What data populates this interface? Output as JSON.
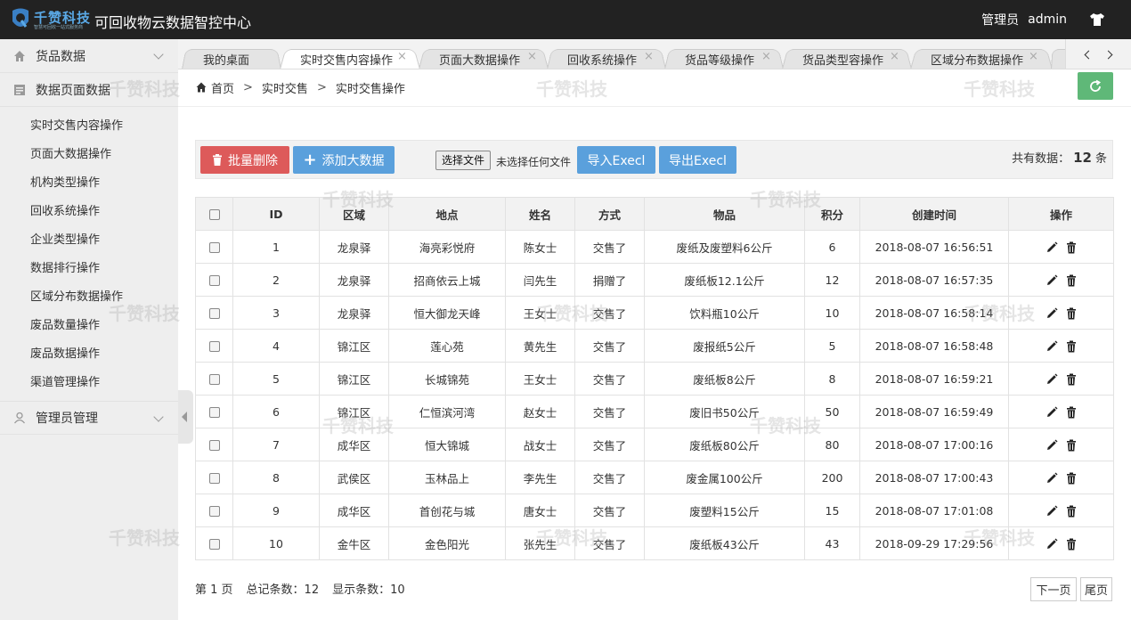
{
  "header": {
    "logo_text": "千赞科技",
    "logo_sub": "智慧可回收一站式服务商",
    "app_title": "可回收物云数据智控中心",
    "admin_role": "管理员",
    "admin_name": "admin"
  },
  "sidebar": {
    "groups": [
      {
        "label": "货品数据",
        "icon": "home-icon"
      },
      {
        "label": "数据页面数据",
        "icon": "document-icon"
      }
    ],
    "items": [
      "实时交售内容操作",
      "页面大数据操作",
      "机构类型操作",
      "回收系统操作",
      "企业类型操作",
      "数据排行操作",
      "区域分布数据操作",
      "废品数量操作",
      "废品数据操作",
      "渠道管理操作"
    ],
    "admin_group": "管理员管理"
  },
  "tabs": [
    "我的桌面",
    "实时交售内容操作",
    "页面大数据操作",
    "回收系统操作",
    "货品等级操作",
    "货品类型容操作",
    "区域分布数据操作"
  ],
  "breadcrumb": {
    "home": "首页",
    "level1": "实时交售",
    "level2": "实时交售操作",
    "sep": ">"
  },
  "toolbar": {
    "batch_delete": "批量删除",
    "add_data": "添加大数据",
    "choose_file": "选择文件",
    "no_file": "未选择任何文件",
    "import": "导入Execl",
    "export": "导出Execl",
    "total_label": "共有数据：",
    "total_count": "12",
    "total_unit": "条"
  },
  "table": {
    "headers": [
      "ID",
      "区域",
      "地点",
      "姓名",
      "方式",
      "物品",
      "积分",
      "创建时间",
      "操作"
    ],
    "rows": [
      [
        "1",
        "龙泉驿",
        "海亮彩悦府",
        "陈女士",
        "交售了",
        "废纸及废塑料6公斤",
        "6",
        "2018-08-07 16:56:51"
      ],
      [
        "2",
        "龙泉驿",
        "招商依云上城",
        "闫先生",
        "捐赠了",
        "废纸板12.1公斤",
        "12",
        "2018-08-07 16:57:35"
      ],
      [
        "3",
        "龙泉驿",
        "恒大御龙天峰",
        "王女士",
        "交售了",
        "饮料瓶10公斤",
        "10",
        "2018-08-07 16:58:14"
      ],
      [
        "4",
        "锦江区",
        "莲心苑",
        "黄先生",
        "交售了",
        "废报纸5公斤",
        "5",
        "2018-08-07 16:58:48"
      ],
      [
        "5",
        "锦江区",
        "长城锦苑",
        "王女士",
        "交售了",
        "废纸板8公斤",
        "8",
        "2018-08-07 16:59:21"
      ],
      [
        "6",
        "锦江区",
        "仁恒滨河湾",
        "赵女士",
        "交售了",
        "废旧书50公斤",
        "50",
        "2018-08-07 16:59:49"
      ],
      [
        "7",
        "成华区",
        "恒大锦城",
        "战女士",
        "交售了",
        "废纸板80公斤",
        "80",
        "2018-08-07 17:00:16"
      ],
      [
        "8",
        "武侯区",
        "玉林品上",
        "李先生",
        "交售了",
        "废金属100公斤",
        "200",
        "2018-08-07 17:00:43"
      ],
      [
        "9",
        "成华区",
        "首创花与城",
        "唐女士",
        "交售了",
        "废塑料15公斤",
        "15",
        "2018-08-07 17:01:08"
      ],
      [
        "10",
        "金牛区",
        "金色阳光",
        "张先生",
        "交售了",
        "废纸板43公斤",
        "43",
        "2018-09-29 17:29:56"
      ]
    ]
  },
  "pager": {
    "page": "第 1 页",
    "total": "总记条数：12",
    "shown": "显示条数：10",
    "next": "下一页",
    "last": "尾页"
  },
  "watermark": "千赞科技",
  "colors": {
    "danger": "#dd5a5a",
    "primary": "#5aa0dc",
    "success": "#5fb878",
    "header": "#222222"
  }
}
